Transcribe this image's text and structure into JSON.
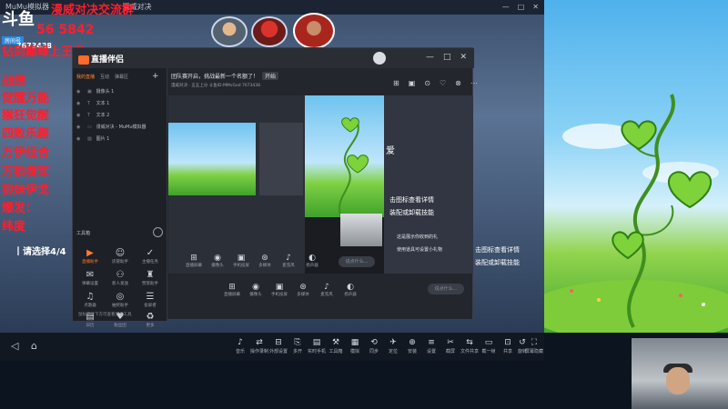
{
  "emulator": {
    "title": "MuMu模拟器",
    "tab": "漫威对决",
    "controls": [
      "—",
      "□",
      "✕"
    ],
    "nav": [
      "◁",
      "⌂"
    ],
    "tools": [
      {
        "icon": "♪",
        "label": "音乐"
      },
      {
        "icon": "⇄",
        "label": "操作录制"
      },
      {
        "icon": "⊟",
        "label": "外部设置"
      },
      {
        "icon": "⎘",
        "label": "多开"
      },
      {
        "icon": "▤",
        "label": "实时手机"
      },
      {
        "icon": "⚒",
        "label": "工具箱"
      },
      {
        "icon": "▦",
        "label": "模拟"
      },
      {
        "icon": "⟲",
        "label": "同步"
      },
      {
        "icon": "✈",
        "label": "定位"
      },
      {
        "icon": "⊕",
        "label": "安装"
      },
      {
        "icon": "≡",
        "label": "设置"
      },
      {
        "icon": "✂",
        "label": "截屏"
      },
      {
        "icon": "⇆",
        "label": "文件共享"
      },
      {
        "icon": "▭",
        "label": "截一帧"
      },
      {
        "icon": "⊡",
        "label": "共享"
      },
      {
        "icon": "↺",
        "label": "旋转"
      },
      {
        "icon": "⛶",
        "label": "屏幕隐藏"
      }
    ]
  },
  "overlay": {
    "logo": "斗鱼",
    "logo_sub": "房间号",
    "room_number": "7673438",
    "qq_text": "漫威对决交流群",
    "qq_number": "56     5842",
    "rank_line": "钻到巅峰上王者",
    "red_lines": [
      "战绩",
      "觉醒万能",
      "猴狂觉醒",
      "四败乐趣",
      "万伊组合",
      "万狼援军",
      "狼妹伊戈",
      "爆发：",
      "纬度"
    ],
    "pick_text": "丨请选择4/4"
  },
  "app": {
    "brand": "直播伴侣",
    "top_title": "团队赛开启，挑战最新一个名额了！",
    "top_btn": "开始",
    "sub_info": "漫威对决 · 五五上分   斗鱼ID:MMvGod   7673438",
    "tabs": [
      "我的直播",
      "互动",
      "弹幕区"
    ],
    "plus": "+",
    "sources": [
      {
        "icon": "▣",
        "label": "摄像头 1"
      },
      {
        "icon": "T",
        "label": "文本 1"
      },
      {
        "icon": "T",
        "label": "文本 2"
      },
      {
        "icon": "▭",
        "label": "漫威对决 - MuMu模拟器"
      },
      {
        "icon": "▨",
        "label": "图片 1"
      }
    ],
    "toolbox_title": "工具箱",
    "toolbox": [
      {
        "icon": "▶",
        "label": "直播助手",
        "active": true
      },
      {
        "icon": "☺",
        "label": "房管助手"
      },
      {
        "icon": "✓",
        "label": "主播任务"
      },
      {
        "icon": "✉",
        "label": "弹幕设置"
      },
      {
        "icon": "⚇",
        "label": "新人发放"
      },
      {
        "icon": "♜",
        "label": "赞赏助手"
      },
      {
        "icon": "♫",
        "label": "点歌器"
      },
      {
        "icon": "◎",
        "label": "抽奖助手"
      },
      {
        "icon": "☰",
        "label": "投屏者"
      },
      {
        "icon": "▤",
        "label": "日历"
      },
      {
        "icon": "♥",
        "label": "粉丝团"
      },
      {
        "icon": "♻",
        "label": "更多"
      }
    ],
    "bottom_note": "鼠标移至下方可查看更多工具",
    "right_tools": [
      "⊞",
      "▣",
      "⊙",
      "♡",
      "⊗",
      "⋯"
    ],
    "window_controls": [
      "—",
      "□",
      "✕"
    ],
    "mid_controls": [
      {
        "icon": "⊞",
        "label": "直播屏幕"
      },
      {
        "icon": "◉",
        "label": "摄像头"
      },
      {
        "icon": "▣",
        "label": "手机投屏"
      },
      {
        "icon": "⊛",
        "label": "多媒体"
      },
      {
        "icon": "♪",
        "label": "麦克风"
      },
      {
        "icon": "◐",
        "label": "扬声器"
      }
    ],
    "mid_controls2": [
      {
        "icon": "⊞",
        "label": "直播屏幕"
      },
      {
        "icon": "◉",
        "label": "摄像头"
      },
      {
        "icon": "▣",
        "label": "手机投屏"
      },
      {
        "icon": "⊛",
        "label": "多媒体"
      },
      {
        "icon": "♪",
        "label": "麦克风"
      },
      {
        "icon": "◐",
        "label": "扬声器"
      }
    ],
    "chat_placeholder": "说点什么...",
    "side_text1": "击图标查看详情",
    "side_text2": "装配或卸载技能",
    "side_text3": "这是展示你收到的礼",
    "side_text4": "使用道具可设置小礼物",
    "side_text5": "击图标查看详情",
    "side_text6": "装配或卸载技能",
    "side_love": "爱"
  },
  "colors": {
    "accent": "#ff7b2e",
    "red_overlay": "#ff1e2d"
  }
}
